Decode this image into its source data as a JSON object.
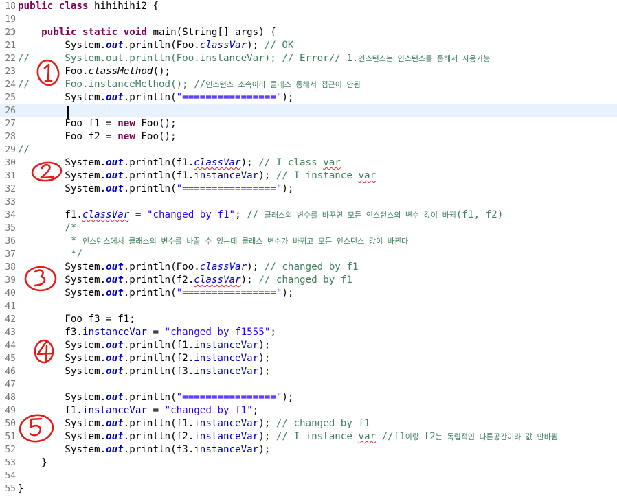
{
  "lines": [
    {
      "num": "18",
      "tokens": [
        {
          "t": "public",
          "c": "kw"
        },
        {
          "t": " "
        },
        {
          "t": "class",
          "c": "kw"
        },
        {
          "t": " hihihihi2 {"
        }
      ]
    },
    {
      "num": "19",
      "tokens": []
    },
    {
      "num": "20",
      "tokens": [
        {
          "t": "    "
        },
        {
          "t": "public",
          "c": "kw"
        },
        {
          "t": " "
        },
        {
          "t": "static",
          "c": "kw"
        },
        {
          "t": " "
        },
        {
          "t": "void",
          "c": "kw"
        },
        {
          "t": " main(String[] args) {"
        }
      ]
    },
    {
      "num": "21",
      "tokens": [
        {
          "t": "        System."
        },
        {
          "t": "out",
          "c": "sout"
        },
        {
          "t": ".println(Foo."
        },
        {
          "t": "classVar",
          "c": "sfld"
        },
        {
          "t": "); "
        },
        {
          "t": "// OK",
          "c": "com"
        }
      ]
    },
    {
      "num": "22",
      "tokens": [
        {
          "t": "//      System.out.println(Foo.instanceVar); // Error// 1.",
          "c": "com"
        },
        {
          "t": "인스턴스는 인스턴스를 통해서 사용가능",
          "c": "com ko"
        }
      ]
    },
    {
      "num": "23",
      "tokens": [
        {
          "t": "        Foo."
        },
        {
          "t": "classMethod",
          "c": "smeth"
        },
        {
          "t": "();"
        }
      ]
    },
    {
      "num": "24",
      "tokens": [
        {
          "t": "//      Foo.instanceMethod(); //",
          "c": "com"
        },
        {
          "t": "인스턴스 소속이라 클래스 통해서 접근이 안됨",
          "c": "com ko"
        }
      ]
    },
    {
      "num": "25",
      "tokens": [
        {
          "t": "        System."
        },
        {
          "t": "out",
          "c": "sout"
        },
        {
          "t": ".println("
        },
        {
          "t": "\"================\"",
          "c": "str"
        },
        {
          "t": ");"
        }
      ]
    },
    {
      "num": "26",
      "tokens": [],
      "current": true
    },
    {
      "num": "27",
      "tokens": [
        {
          "t": "        Foo f1 = "
        },
        {
          "t": "new",
          "c": "kw"
        },
        {
          "t": " Foo();"
        }
      ]
    },
    {
      "num": "28",
      "tokens": [
        {
          "t": "        Foo f2 = "
        },
        {
          "t": "new",
          "c": "kw"
        },
        {
          "t": " Foo();"
        }
      ]
    },
    {
      "num": "29",
      "tokens": [
        {
          "t": "//",
          "c": "com"
        }
      ]
    },
    {
      "num": "30",
      "tokens": [
        {
          "t": "        System."
        },
        {
          "t": "out",
          "c": "sout"
        },
        {
          "t": ".println(f1."
        },
        {
          "t": "classVar",
          "c": "sfld warn"
        },
        {
          "t": "); "
        },
        {
          "t": "// I class ",
          "c": "com"
        },
        {
          "t": "var",
          "c": "com warn"
        }
      ]
    },
    {
      "num": "31",
      "tokens": [
        {
          "t": "        System."
        },
        {
          "t": "out",
          "c": "sout"
        },
        {
          "t": ".println(f1."
        },
        {
          "t": "instanceVar",
          "c": "fld"
        },
        {
          "t": "); "
        },
        {
          "t": "// I instance ",
          "c": "com"
        },
        {
          "t": "var",
          "c": "com warn"
        }
      ]
    },
    {
      "num": "32",
      "tokens": [
        {
          "t": "        System."
        },
        {
          "t": "out",
          "c": "sout"
        },
        {
          "t": ".println("
        },
        {
          "t": "\"================\"",
          "c": "str"
        },
        {
          "t": ");"
        }
      ]
    },
    {
      "num": "33",
      "tokens": []
    },
    {
      "num": "34",
      "tokens": [
        {
          "t": "        f1."
        },
        {
          "t": "classVar",
          "c": "sfld warn"
        },
        {
          "t": " = "
        },
        {
          "t": "\"changed by f1\"",
          "c": "str"
        },
        {
          "t": "; "
        },
        {
          "t": "// ",
          "c": "com"
        },
        {
          "t": "클래스의 변수를 바꾸면 모든 인스턴스의 변수 값이 바뀜",
          "c": "com ko"
        },
        {
          "t": "(f1, f2)",
          "c": "com"
        }
      ]
    },
    {
      "num": "35",
      "tokens": [
        {
          "t": "        /*",
          "c": "com"
        }
      ]
    },
    {
      "num": "36",
      "tokens": [
        {
          "t": "         * ",
          "c": "com"
        },
        {
          "t": "인스턴스에서 클래스의 변수를 바꿀 수 있는데 클래스 변수가 바뀌고 모든 인스턴스 값이 바뀐다",
          "c": "com ko"
        }
      ]
    },
    {
      "num": "37",
      "tokens": [
        {
          "t": "         */",
          "c": "com"
        }
      ]
    },
    {
      "num": "38",
      "tokens": [
        {
          "t": "        System."
        },
        {
          "t": "out",
          "c": "sout"
        },
        {
          "t": ".println(Foo."
        },
        {
          "t": "classVar",
          "c": "sfld"
        },
        {
          "t": "); "
        },
        {
          "t": "// changed by f1",
          "c": "com"
        }
      ]
    },
    {
      "num": "39",
      "tokens": [
        {
          "t": "        System."
        },
        {
          "t": "out",
          "c": "sout"
        },
        {
          "t": ".println(f2."
        },
        {
          "t": "classVar",
          "c": "sfld warn"
        },
        {
          "t": "); "
        },
        {
          "t": "// changed by f1",
          "c": "com"
        }
      ]
    },
    {
      "num": "40",
      "tokens": [
        {
          "t": "        System."
        },
        {
          "t": "out",
          "c": "sout"
        },
        {
          "t": ".println("
        },
        {
          "t": "\"================\"",
          "c": "str"
        },
        {
          "t": ");"
        }
      ]
    },
    {
      "num": "41",
      "tokens": []
    },
    {
      "num": "42",
      "tokens": [
        {
          "t": "        Foo f3 = f1;"
        }
      ]
    },
    {
      "num": "43",
      "tokens": [
        {
          "t": "        f3."
        },
        {
          "t": "instanceVar",
          "c": "fld"
        },
        {
          "t": " = "
        },
        {
          "t": "\"changed by f1555\"",
          "c": "str"
        },
        {
          "t": ";"
        }
      ]
    },
    {
      "num": "44",
      "tokens": [
        {
          "t": "        System."
        },
        {
          "t": "out",
          "c": "sout"
        },
        {
          "t": ".println(f1."
        },
        {
          "t": "instanceVar",
          "c": "fld"
        },
        {
          "t": ");"
        }
      ]
    },
    {
      "num": "45",
      "tokens": [
        {
          "t": "        System."
        },
        {
          "t": "out",
          "c": "sout"
        },
        {
          "t": ".println(f2."
        },
        {
          "t": "instanceVar",
          "c": "fld"
        },
        {
          "t": ");"
        }
      ]
    },
    {
      "num": "46",
      "tokens": [
        {
          "t": "        System."
        },
        {
          "t": "out",
          "c": "sout"
        },
        {
          "t": ".println(f3."
        },
        {
          "t": "instanceVar",
          "c": "fld"
        },
        {
          "t": ");"
        }
      ]
    },
    {
      "num": "47",
      "tokens": []
    },
    {
      "num": "48",
      "tokens": [
        {
          "t": "        System."
        },
        {
          "t": "out",
          "c": "sout"
        },
        {
          "t": ".println("
        },
        {
          "t": "\"================\"",
          "c": "str"
        },
        {
          "t": ");"
        }
      ]
    },
    {
      "num": "49",
      "tokens": [
        {
          "t": "        f1."
        },
        {
          "t": "instanceVar",
          "c": "fld"
        },
        {
          "t": " = "
        },
        {
          "t": "\"changed by f1\"",
          "c": "str"
        },
        {
          "t": ";"
        }
      ]
    },
    {
      "num": "50",
      "tokens": [
        {
          "t": "        System."
        },
        {
          "t": "out",
          "c": "sout"
        },
        {
          "t": ".println(f1."
        },
        {
          "t": "instanceVar",
          "c": "fld"
        },
        {
          "t": "); "
        },
        {
          "t": "// changed by f1",
          "c": "com"
        }
      ]
    },
    {
      "num": "51",
      "tokens": [
        {
          "t": "        System."
        },
        {
          "t": "out",
          "c": "sout"
        },
        {
          "t": ".println(f2."
        },
        {
          "t": "instanceVar",
          "c": "fld"
        },
        {
          "t": "); "
        },
        {
          "t": "// I instance ",
          "c": "com"
        },
        {
          "t": "var",
          "c": "com warn"
        },
        {
          "t": " //f1",
          "c": "com"
        },
        {
          "t": "이랑 ",
          "c": "com ko"
        },
        {
          "t": "f2",
          "c": "com"
        },
        {
          "t": "는 독립적인 다른공간이라 값 안바뀜",
          "c": "com ko"
        }
      ]
    },
    {
      "num": "52",
      "tokens": [
        {
          "t": "        System."
        },
        {
          "t": "out",
          "c": "sout"
        },
        {
          "t": ".println(f3."
        },
        {
          "t": "instanceVar",
          "c": "fld"
        },
        {
          "t": ");"
        }
      ]
    },
    {
      "num": "53",
      "tokens": [
        {
          "t": "    }"
        }
      ]
    },
    {
      "num": "54",
      "tokens": []
    },
    {
      "num": "55",
      "tokens": [
        {
          "t": "}"
        }
      ]
    }
  ],
  "annotations": [
    "1",
    "2",
    "3",
    "4",
    "5"
  ],
  "colors": {
    "keyword": "#7f0055",
    "field": "#0000c0",
    "string": "#2a00ff",
    "comment": "#3f7f5f",
    "line_number": "#787878",
    "current_line": "#e8f2fe",
    "annotation_ink": "#e21b1b"
  },
  "icons": {
    "fold": "collapse-minus-icon"
  }
}
